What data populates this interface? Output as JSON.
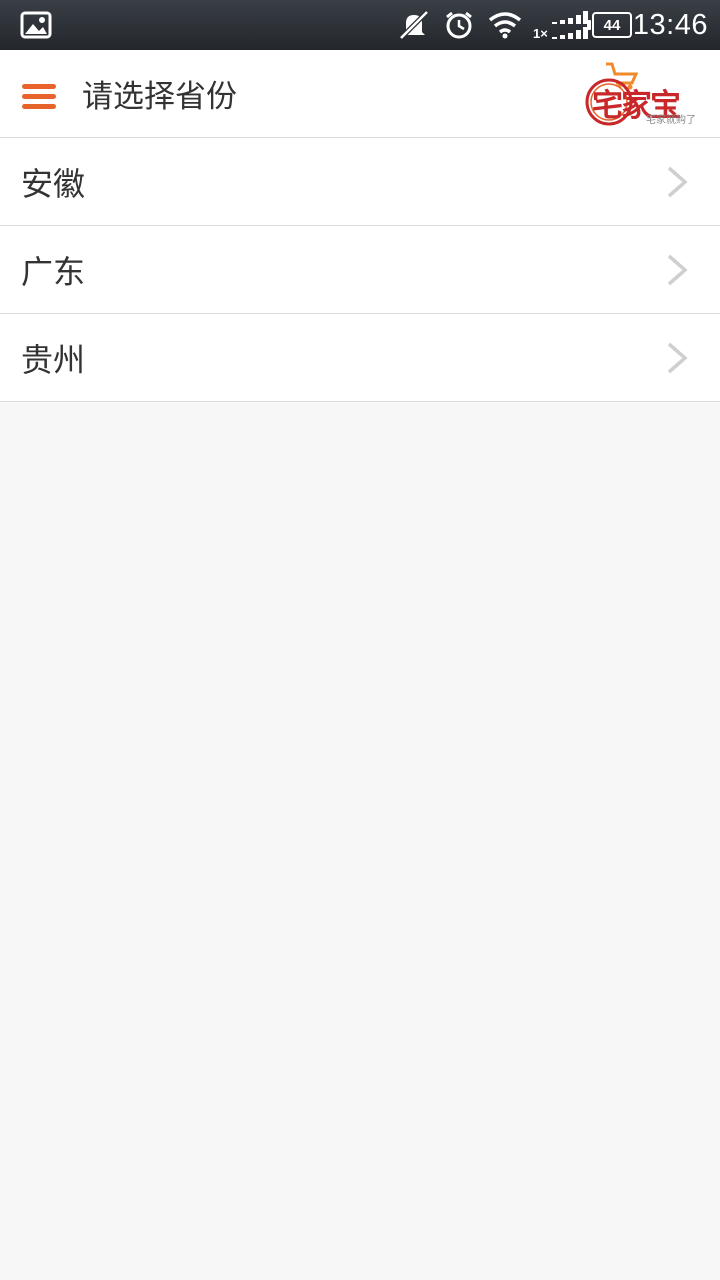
{
  "status_bar": {
    "time": "13:46",
    "battery_level": "44",
    "signal_label": "1×",
    "icons": [
      "image-notification-icon",
      "mute-icon",
      "alarm-icon",
      "wifi-icon",
      "signal-icon",
      "battery-icon"
    ]
  },
  "app_bar": {
    "title": "请选择省份",
    "menu_icon": "hamburger-menu-icon",
    "logo_text": "宅家宝",
    "logo_slogan": "宅家就购了",
    "accent_color": "#e8632b"
  },
  "provinces": [
    {
      "label": "安徽",
      "icon": "chevron-right-icon"
    },
    {
      "label": "广东",
      "icon": "chevron-right-icon"
    },
    {
      "label": "贵州",
      "icon": "chevron-right-icon"
    }
  ]
}
